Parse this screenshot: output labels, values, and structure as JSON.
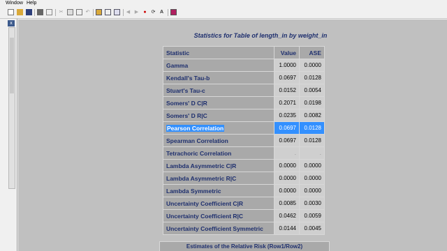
{
  "menu": {
    "window": "Window",
    "help": "Help"
  },
  "toolbar": {
    "font_button_label": "A"
  },
  "left_pane": {
    "close_label": "x"
  },
  "results": {
    "caption": "Statistics for Table of length_in by weight_in",
    "headers": {
      "statistic": "Statistic",
      "value": "Value",
      "ase": "ASE"
    },
    "rows": [
      {
        "statistic": "Gamma",
        "value": "1.0000",
        "ase": "0.0000"
      },
      {
        "statistic": "Kendall's Tau-b",
        "value": "0.0697",
        "ase": "0.0128"
      },
      {
        "statistic": "Stuart's Tau-c",
        "value": "0.0152",
        "ase": "0.0054"
      },
      {
        "statistic": "Somers' D C|R",
        "value": "0.2071",
        "ase": "0.0198"
      },
      {
        "statistic": "Somers' D R|C",
        "value": "0.0235",
        "ase": "0.0082"
      },
      {
        "statistic": "Pearson Correlation",
        "value": "0.0697",
        "ase": "0.0128"
      },
      {
        "statistic": "Spearman Correlation",
        "value": "0.0697",
        "ase": "0.0128"
      },
      {
        "statistic": "Tetrachoric Correlation",
        "value": ".",
        "ase": "."
      },
      {
        "statistic": "Lambda Asymmetric C|R",
        "value": "0.0000",
        "ase": "0.0000"
      },
      {
        "statistic": "Lambda Asymmetric R|C",
        "value": "0.0000",
        "ase": "0.0000"
      },
      {
        "statistic": "Lambda Symmetric",
        "value": "0.0000",
        "ase": "0.0000"
      },
      {
        "statistic": "Uncertainty Coefficient C|R",
        "value": "0.0085",
        "ase": "0.0030"
      },
      {
        "statistic": "Uncertainty Coefficient R|C",
        "value": "0.0462",
        "ase": "0.0059"
      },
      {
        "statistic": "Uncertainty Coefficient Symmetric",
        "value": "0.0144",
        "ase": "0.0045"
      }
    ],
    "next_table_caption": "Estimates of the Relative Risk (Row1/Row2)"
  },
  "colors": {
    "table_label_text": "#1e2f6e",
    "header_bg": "#a9a9a9",
    "cell_bg": "#cfcfcf",
    "selection": "#3390ff"
  }
}
